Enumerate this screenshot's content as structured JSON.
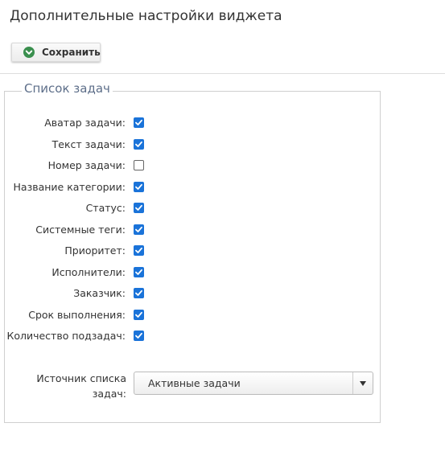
{
  "page": {
    "title": "Дополнительные настройки виджета"
  },
  "toolbar": {
    "save_label": "Сохранить",
    "save_icon": "check-circle-icon",
    "save_icon_color": "#3a8f4e"
  },
  "tasklist": {
    "legend": "Список задач",
    "accent_color": "#1a73d9",
    "options": [
      {
        "label": "Аватар задачи:",
        "checked": true
      },
      {
        "label": "Текст задачи:",
        "checked": true
      },
      {
        "label": "Номер задачи:",
        "checked": false
      },
      {
        "label": "Название категории:",
        "checked": true
      },
      {
        "label": "Статус:",
        "checked": true
      },
      {
        "label": "Системные теги:",
        "checked": true
      },
      {
        "label": "Приоритет:",
        "checked": true
      },
      {
        "label": "Исполнители:",
        "checked": true
      },
      {
        "label": "Заказчик:",
        "checked": true
      },
      {
        "label": "Срок выполнения:",
        "checked": true
      },
      {
        "label": "Количество подзадач:",
        "checked": true
      }
    ],
    "source": {
      "label": "Источник списка задач:",
      "selected": "Активные задачи",
      "arrow_icon": "triangle-down-icon"
    }
  }
}
